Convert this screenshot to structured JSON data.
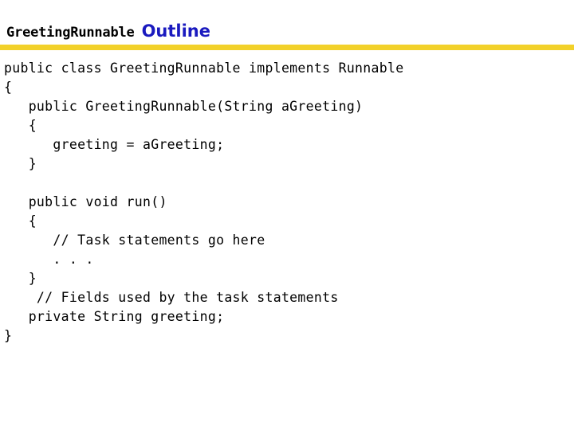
{
  "slide": {
    "title": {
      "class_name": "GreetingRunnable",
      "heading_word": "Outline"
    },
    "divider": {
      "color": "#F2D12A"
    },
    "colors": {
      "heading_blue": "#1a1aBF",
      "rule_yellow": "#F2D12A",
      "code_black": "#000000",
      "background": "#ffffff"
    },
    "code": {
      "language": "java",
      "lines": [
        "public class GreetingRunnable implements Runnable",
        "{",
        "   public GreetingRunnable(String aGreeting)",
        "   {",
        "      greeting = aGreeting;",
        "   }",
        "",
        "   public void run()",
        "   {",
        "      // Task statements go here",
        "      . . .",
        "   }",
        "    // Fields used by the task statements",
        "   private String greeting;",
        "}"
      ]
    }
  }
}
